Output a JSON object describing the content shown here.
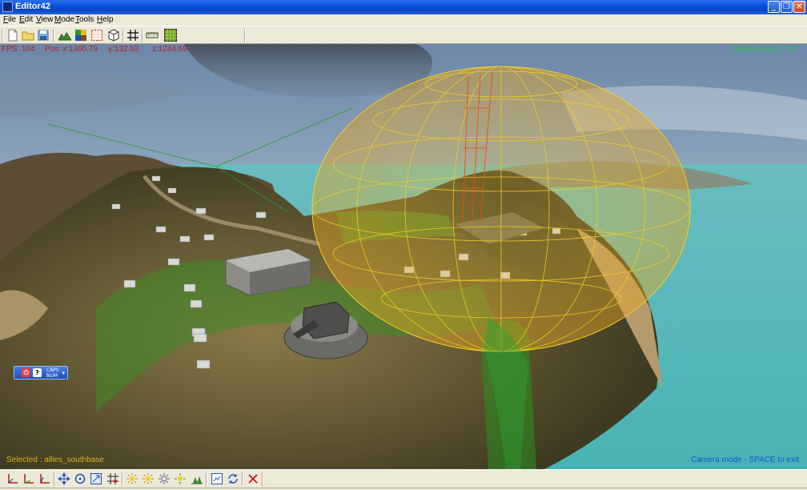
{
  "window": {
    "title": "Editor42",
    "minimize_glyph": "_",
    "maximize_glyph": "❐",
    "close_glyph": "✕"
  },
  "menu": {
    "items": [
      "File",
      "Edit",
      "View",
      "Mode",
      "Tools",
      "Help"
    ]
  },
  "toolbar_top": {
    "icons": [
      "new-file-icon",
      "open-folder-icon",
      "save-icon",
      "terrain-icon",
      "texture-paint-icon",
      "selection-rect-icon",
      "cube-icon",
      "grid-icon",
      "ruler-icon",
      "grid-color-icon"
    ]
  },
  "viewport": {
    "fps_label": "FPS:",
    "fps_value": "104",
    "pos_label": "Pos:",
    "pos_x": "x:1360.79",
    "pos_y": "y:132.03",
    "pos_z": "z:1244.69",
    "statics_count": "Statics count : 747",
    "selected": "Selected : allies_southbase",
    "camera_mode": "Camera mode - SPACE to exit"
  },
  "caps_widget": {
    "line1": "CAPS",
    "line2": "NUM",
    "drop_glyph": "▾",
    "help_glyph": "?",
    "power_glyph": "⏻"
  },
  "toolbar_bottom": {
    "icons": [
      "axis-xy-icon",
      "axis-xz-icon",
      "axis-yz-icon",
      "move-icon",
      "rotate-icon",
      "scale-icon",
      "snap-grid-icon",
      "light-1-icon",
      "light-2-icon",
      "light-3-icon",
      "light-4-icon",
      "tree-group-icon",
      "properties-icon",
      "refresh-icon",
      "delete-icon"
    ]
  },
  "colors": {
    "titlebar": "#0a4fd6",
    "chrome": "#ece9d8",
    "overlay_red": "#b52020",
    "statics_green": "#23c23a",
    "selected_yellow": "#d9b020",
    "camera_blue": "#2050d8",
    "dome_wire": "#f5d020",
    "sea": "#4fb8b8"
  }
}
